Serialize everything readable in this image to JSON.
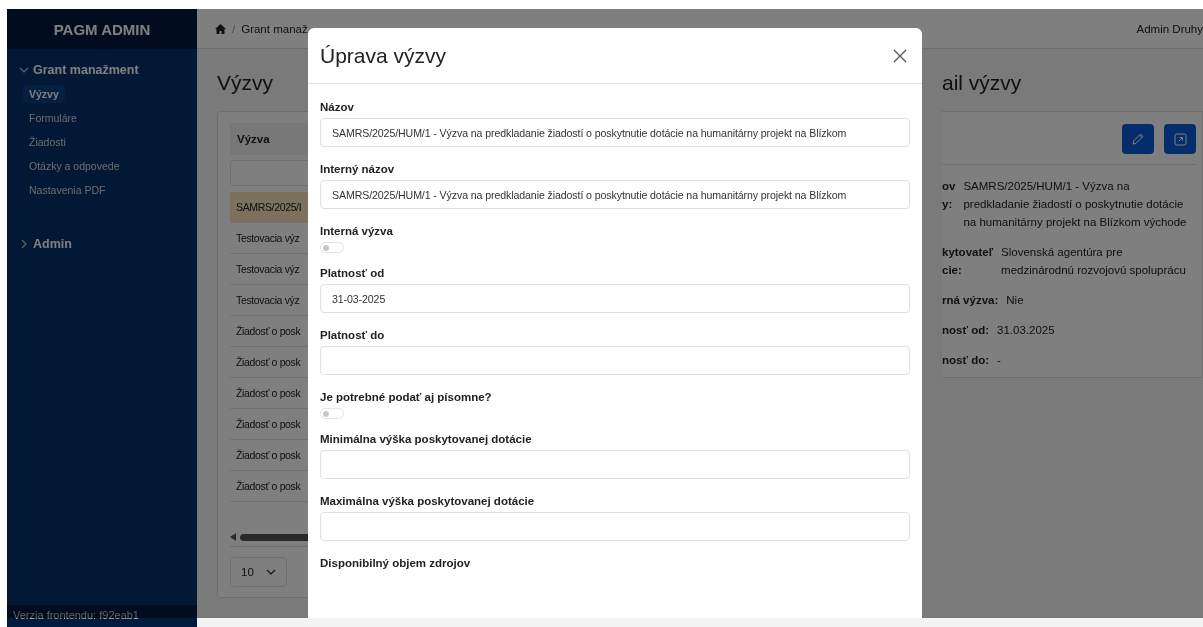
{
  "sidebar": {
    "logo": "PAGM ADMIN",
    "groups": [
      {
        "label": "Grant manažment",
        "expanded": true,
        "children": [
          {
            "label": "Výzvy",
            "selected": true
          },
          {
            "label": "Formuláre",
            "selected": false
          },
          {
            "label": "Žiadosti",
            "selected": false
          },
          {
            "label": "Otázky a odpovede",
            "selected": false
          },
          {
            "label": "Nastavenia PDF",
            "selected": false
          }
        ]
      },
      {
        "label": "Admin",
        "expanded": false
      }
    ],
    "footer": "Verzia frontendu: f92eab1"
  },
  "top_bar": {
    "separator": "/",
    "breadcrumb": [
      "Grant manaž"
    ],
    "user": "Admin Druhy"
  },
  "list_panel": {
    "title": "Výzvy",
    "column": "Výzva",
    "rows": [
      {
        "text": "SAMRS/2025/I",
        "selected": true
      },
      {
        "text": "Testovacia výz",
        "selected": false
      },
      {
        "text": "Testovacia výz",
        "selected": false
      },
      {
        "text": "Testovacia výz",
        "selected": false
      },
      {
        "text": "Žiadosť o posk",
        "selected": false
      },
      {
        "text": "Žiadosť o posk",
        "selected": false
      },
      {
        "text": "Žiadosť o posk",
        "selected": false
      },
      {
        "text": "Žiadosť o posk",
        "selected": false
      },
      {
        "text": "Žiadosť o posk",
        "selected": false
      },
      {
        "text": "Žiadosť o posk",
        "selected": false
      }
    ],
    "page_size": "10"
  },
  "detail_panel": {
    "title": "ail výzvy",
    "fields": [
      {
        "label": "ov\ny:",
        "value": "SAMRS/2025/HUM/1 - Výzva na predkladanie žiadostí o poskytnutie dotácie na humanitárny projekt na Blízkom východe"
      },
      {
        "label": "kytovateľ\ncie:",
        "value": "Slovenská agentúra pre medzinárodnú rozvojovú spoluprácu"
      },
      {
        "label": "rná výzva:",
        "value": "Nie"
      },
      {
        "label": "nosť od:",
        "value": "31.03.2025"
      },
      {
        "label": "nosť do:",
        "value": "-"
      }
    ]
  },
  "modal": {
    "title": "Úprava výzvy",
    "fields": [
      {
        "kind": "text",
        "label": "Názov",
        "value": "SAMRS/2025/HUM/1 - Výzva na predkladanie žiadostí o poskytnutie dotácie na humanitárny projekt na Blízkom"
      },
      {
        "kind": "text",
        "label": "Interný názov",
        "value": "SAMRS/2025/HUM/1 - Výzva na predkladanie žiadostí o poskytnutie dotácie na humanitárny projekt na Blízkom"
      },
      {
        "kind": "toggle",
        "label": "Interná výzva",
        "on": false
      },
      {
        "kind": "text",
        "label": "Platnosť od",
        "value": "31-03-2025"
      },
      {
        "kind": "text",
        "label": "Platnosť do"
      },
      {
        "kind": "toggle",
        "label": "Je potrebné podať aj písomne?",
        "on": false
      },
      {
        "kind": "text",
        "label": "Minimálna výška poskytovanej dotácie"
      },
      {
        "kind": "text",
        "label": "Maximálna výška poskytovanej dotácie"
      },
      {
        "kind": "caption",
        "label": "Disponibilný objem zdrojov"
      }
    ]
  }
}
